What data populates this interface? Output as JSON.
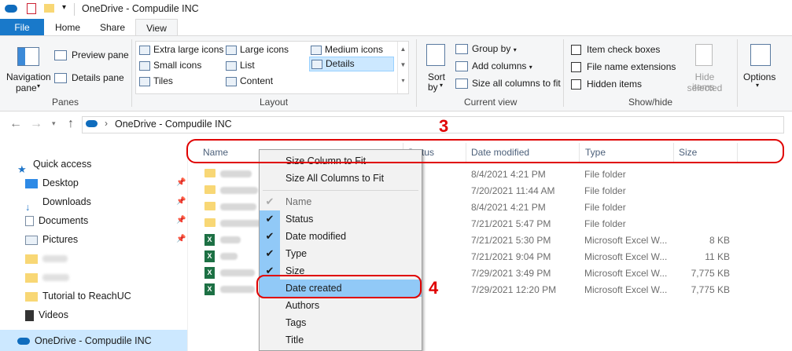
{
  "titlebar": {
    "title": "OneDrive - Compudile INC"
  },
  "tabs": [
    "File",
    "Home",
    "Share",
    "View"
  ],
  "ribbon": {
    "panes": {
      "nav_pane_label": "Navigation",
      "nav_pane_label2": "pane",
      "preview_pane": "Preview pane",
      "details_pane": "Details pane",
      "group": "Panes"
    },
    "layout": {
      "items": [
        "Extra large icons",
        "Large icons",
        "Medium icons",
        "Small icons",
        "List",
        "Details",
        "Tiles",
        "Content"
      ],
      "group": "Layout"
    },
    "current_view": {
      "sort_by": "Sort",
      "sort_by2": "by",
      "group_by": "Group by",
      "add_columns": "Add columns",
      "size_all": "Size all columns to fit",
      "group": "Current view"
    },
    "show_hide": {
      "item_checkboxes": "Item check boxes",
      "file_ext": "File name extensions",
      "hidden_items": "Hidden items",
      "hide_selected": "Hide selected",
      "hide_selected2": "items",
      "group": "Show/hide"
    },
    "options": {
      "label": "Options"
    }
  },
  "address": {
    "path": "OneDrive - Compudile INC"
  },
  "nav": {
    "items": [
      "Quick access",
      "Desktop",
      "Downloads",
      "Documents",
      "Pictures",
      "Tutorial to ReachUC",
      "Videos",
      "OneDrive - Compudile INC"
    ]
  },
  "columns": [
    "Name",
    "Status",
    "Date modified",
    "Type",
    "Size"
  ],
  "rows": [
    {
      "date": "8/4/2021 4:21 PM",
      "type": "File folder",
      "size": "",
      "kind": "folder"
    },
    {
      "date": "7/20/2021 11:44 AM",
      "type": "File folder",
      "size": "",
      "kind": "folder"
    },
    {
      "date": "8/4/2021 4:21 PM",
      "type": "File folder",
      "size": "",
      "kind": "folder"
    },
    {
      "date": "7/21/2021 5:47 PM",
      "type": "File folder",
      "size": "",
      "kind": "folder"
    },
    {
      "date": "7/21/2021 5:30 PM",
      "type": "Microsoft Excel W...",
      "size": "8 KB",
      "kind": "excel"
    },
    {
      "date": "7/21/2021 9:04 PM",
      "type": "Microsoft Excel W...",
      "size": "11 KB",
      "kind": "excel"
    },
    {
      "date": "7/29/2021 3:49 PM",
      "type": "Microsoft Excel W...",
      "size": "7,775 KB",
      "kind": "excel"
    },
    {
      "date": "7/29/2021 12:20 PM",
      "type": "Microsoft Excel W...",
      "size": "7,775 KB",
      "kind": "excel"
    }
  ],
  "context_menu": {
    "items": [
      {
        "label": "Size Column to Fit",
        "checked": false
      },
      {
        "label": "Size All Columns to Fit",
        "checked": false
      },
      {
        "label": "Name",
        "checked": true,
        "disabled": true
      },
      {
        "label": "Status",
        "checked": true
      },
      {
        "label": "Date modified",
        "checked": true
      },
      {
        "label": "Type",
        "checked": true
      },
      {
        "label": "Size",
        "checked": true
      },
      {
        "label": "Date created",
        "checked": false,
        "highlighted": true
      },
      {
        "label": "Authors",
        "checked": false
      },
      {
        "label": "Tags",
        "checked": false
      },
      {
        "label": "Title",
        "checked": false
      }
    ]
  },
  "annotations": {
    "step3": "3",
    "step4": "4",
    "color": "#e00000"
  }
}
